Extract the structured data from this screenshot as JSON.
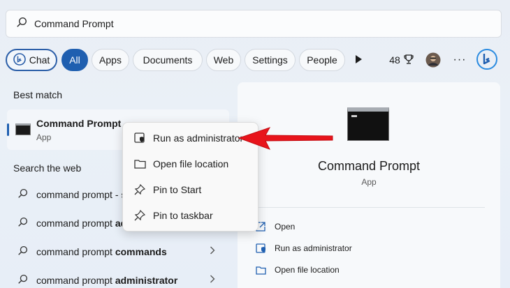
{
  "search": {
    "value": "Command Prompt"
  },
  "filters": {
    "chat": "Chat",
    "all": "All",
    "apps": "Apps",
    "documents": "Documents",
    "web": "Web",
    "settings": "Settings",
    "people": "People",
    "points": "48",
    "more": "···"
  },
  "best_match": {
    "heading": "Best match",
    "title": "Command Prompt",
    "subtitle": "App"
  },
  "search_web": {
    "heading": "Search the web",
    "items": [
      {
        "plain": "command prompt - ",
        "bold": "s"
      },
      {
        "plain": "command prompt ",
        "bold": "ad"
      },
      {
        "plain": "command prompt ",
        "bold": "commands"
      },
      {
        "plain": "command prompt ",
        "bold": "administrator"
      }
    ]
  },
  "context_menu": {
    "items": [
      {
        "label": "Run as administrator",
        "icon": "shield-icon"
      },
      {
        "label": "Open file location",
        "icon": "folder-icon"
      },
      {
        "label": "Pin to Start",
        "icon": "pin-icon"
      },
      {
        "label": "Pin to taskbar",
        "icon": "pin-icon"
      }
    ]
  },
  "details": {
    "title": "Command Prompt",
    "subtitle": "App",
    "actions": [
      {
        "label": "Open",
        "icon": "open-icon"
      },
      {
        "label": "Run as administrator",
        "icon": "shield-icon"
      },
      {
        "label": "Open file location",
        "icon": "folder-icon"
      }
    ]
  },
  "colors": {
    "accent": "#1f5fb0",
    "arrow": "#e8141b"
  }
}
